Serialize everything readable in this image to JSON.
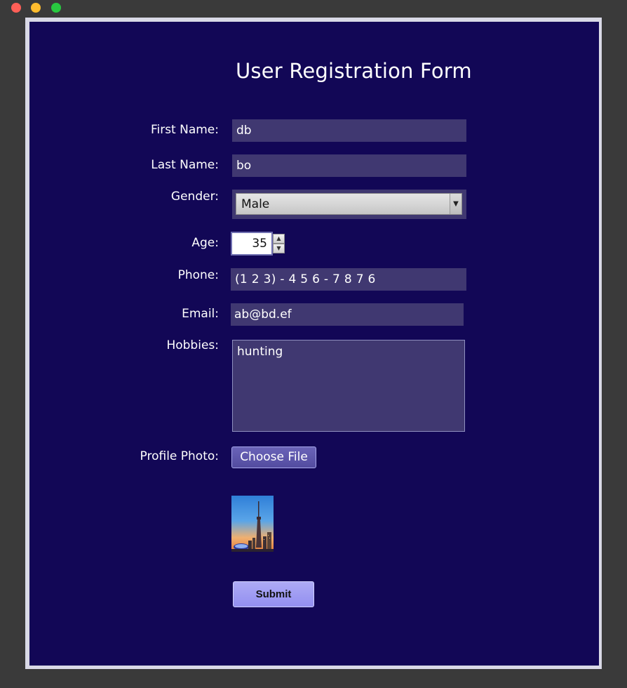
{
  "window": {
    "controls": [
      "close",
      "minimize",
      "maximize"
    ]
  },
  "form": {
    "title": "User Registration Form",
    "first_name": {
      "label": "First Name:",
      "value": "db"
    },
    "last_name": {
      "label": "Last Name:",
      "value": "bo"
    },
    "gender": {
      "label": "Gender:",
      "value": "Male"
    },
    "age": {
      "label": "Age:",
      "value": "35"
    },
    "phone": {
      "label": "Phone:",
      "value": "(1 2 3) - 4 5 6 - 7 8 7 6"
    },
    "email": {
      "label": "Email:",
      "value": "ab@bd.ef"
    },
    "hobbies": {
      "label": "Hobbies:",
      "value": "hunting"
    },
    "profile_photo": {
      "label": "Profile Photo:",
      "button": "Choose File"
    },
    "submit": "Submit"
  },
  "colors": {
    "background": "#120756",
    "field": "#403871",
    "submit": "#9d99f2"
  },
  "icons": {
    "select_arrow": "chevron-down-icon",
    "spin_up": "chevron-up-icon",
    "spin_down": "chevron-down-icon"
  }
}
